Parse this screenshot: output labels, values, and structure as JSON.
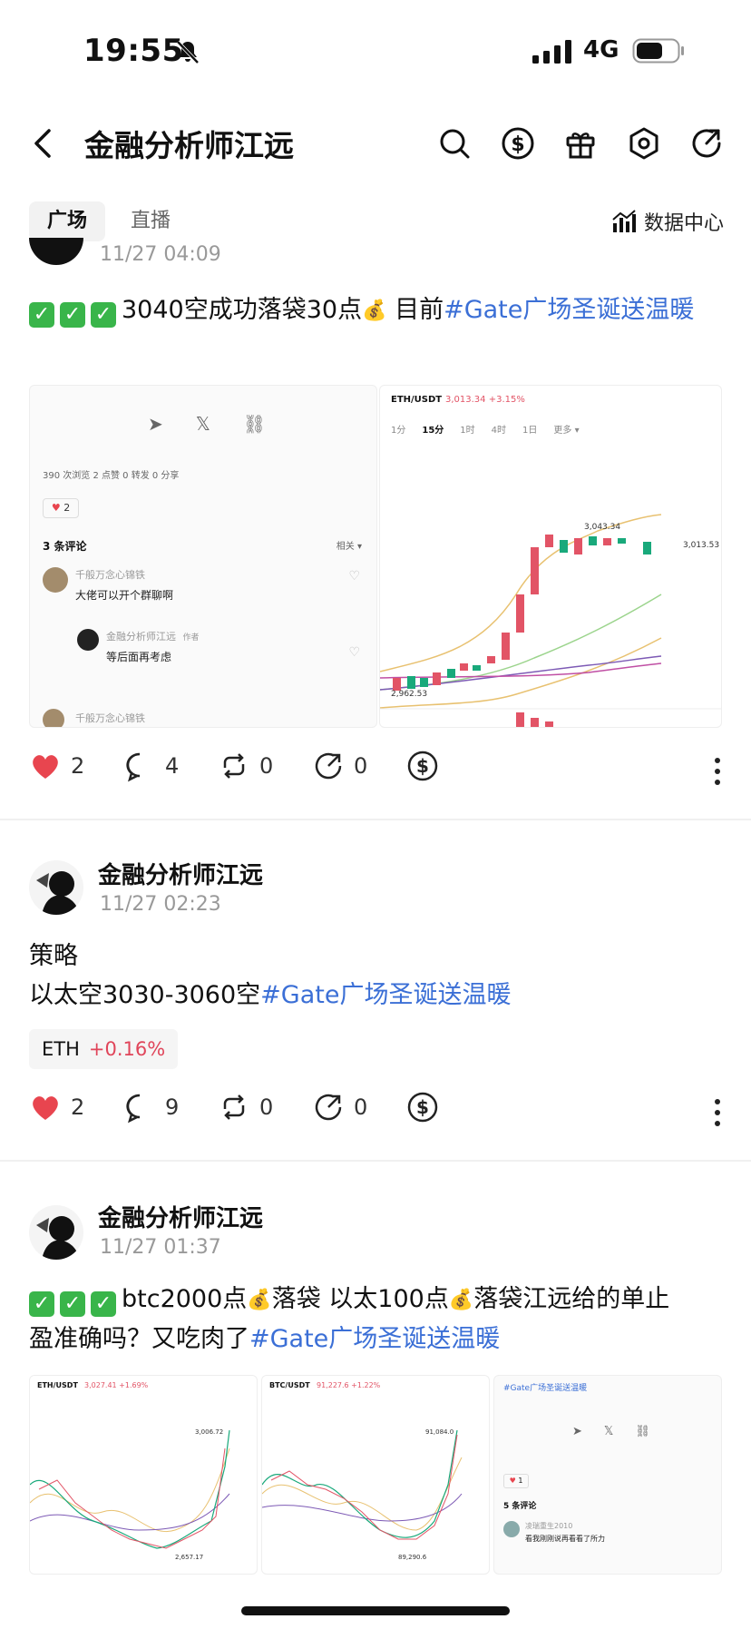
{
  "status_bar": {
    "time": "19:55",
    "network": "4G"
  },
  "header": {
    "title": "金融分析师江远"
  },
  "tabs": [
    {
      "label": "广场",
      "active": true
    },
    {
      "label": "直播",
      "active": false
    }
  ],
  "data_center_label": "数据中心",
  "posts": [
    {
      "time": "11/27 04:09",
      "text_main": "3040空成功落袋30点",
      "text_mid": "目前",
      "hashtag": "#Gate广场圣诞送温暖",
      "stats": {
        "likes": "2",
        "comments": "4",
        "reposts": "0",
        "shares": "0"
      },
      "thumbs": {
        "left": {
          "likes": "2",
          "comment_header": "3 条评论",
          "sort": "相关 ▾",
          "c1_user": "千般万念心锦铁",
          "c1_text": "大佬可以开个群聊啊",
          "c2_user": "金融分析师江远",
          "c2_tag": "作者",
          "c2_text": "等后面再考虑",
          "c3_user": "千般万念心锦铁",
          "stats_row": "390 次浏览   2 点赞   0 转发   0 分享"
        },
        "right": {
          "pair": "ETH/USDT",
          "price": "3,013.34 +3.15%",
          "intervals": [
            "1分",
            "15分",
            "1时",
            "4时",
            "1日",
            "更多 ▾"
          ],
          "high": "3,043.34",
          "low": "2,962.53",
          "last": "3,013.53"
        }
      }
    },
    {
      "author": "金融分析师江远",
      "time": "11/27 02:23",
      "line1": "策略",
      "line2": "以太空3030-3060空",
      "hashtag": "#Gate广场圣诞送温暖",
      "coin": {
        "symbol": "ETH",
        "change": "+0.16%"
      },
      "stats": {
        "likes": "2",
        "comments": "9",
        "reposts": "0",
        "shares": "0"
      }
    },
    {
      "author": "金融分析师江远",
      "time": "11/27 01:37",
      "text_a": "btc2000点",
      "text_b": "落袋 以太100点",
      "text_c": "落袋江远给的单止",
      "text_d": "盈准确吗？又吃肉了",
      "hashtag": "#Gate广场圣诞送温暖",
      "thumbs": {
        "a": {
          "pair": "ETH/USDT",
          "price": "3,027.41 +1.69%",
          "high": "3,006.72",
          "low": "2,657.17"
        },
        "b": {
          "pair": "BTC/USDT",
          "price": "91,227.6 +1.22%",
          "high": "91,084.0",
          "low": "89,290.6"
        },
        "c": {
          "tag": "#Gate广场圣诞送温暖",
          "comments": "5 条评论",
          "likes": "1",
          "user": "凌瑞重生2010",
          "text": "看我刚刚说再看看了所力"
        }
      }
    }
  ],
  "colors": {
    "accent": "#3b6fd6",
    "like": "#e8454f",
    "up": "#19a97b",
    "down": "#e25466"
  }
}
